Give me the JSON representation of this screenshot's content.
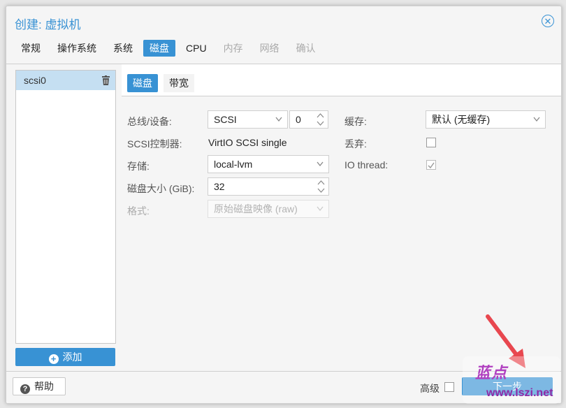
{
  "window": {
    "title": "创建: 虚拟机"
  },
  "tabs": [
    {
      "label": "常规",
      "state": "normal"
    },
    {
      "label": "操作系统",
      "state": "normal"
    },
    {
      "label": "系统",
      "state": "normal"
    },
    {
      "label": "磁盘",
      "state": "active"
    },
    {
      "label": "CPU",
      "state": "normal"
    },
    {
      "label": "内存",
      "state": "disabled"
    },
    {
      "label": "网络",
      "state": "disabled"
    },
    {
      "label": "确认",
      "state": "disabled"
    }
  ],
  "disk_list": {
    "items": [
      {
        "label": "scsi0"
      }
    ],
    "add_label": "添加"
  },
  "inner_tabs": {
    "disk": "磁盘",
    "bandwidth": "带宽"
  },
  "form": {
    "bus_label": "总线/设备:",
    "bus_value": "SCSI",
    "device_value": "0",
    "controller_label": "SCSI控制器:",
    "controller_value": "VirtIO SCSI single",
    "storage_label": "存储:",
    "storage_value": "local-lvm",
    "size_label": "磁盘大小 (GiB):",
    "size_value": "32",
    "format_label": "格式:",
    "format_value": "原始磁盘映像 (raw)",
    "cache_label": "缓存:",
    "cache_value": "默认 (无缓存)",
    "discard_label": "丢弃:",
    "discard_checked": false,
    "iothread_label": "IO thread:",
    "iothread_checked": true
  },
  "footer": {
    "help_label": "帮助",
    "advanced_label": "高级",
    "next_label": "下一步"
  },
  "watermark": {
    "logo": "蓝点",
    "url": "www.lszi.net"
  },
  "colors": {
    "accent": "#3892d4",
    "selection": "#c5dff2",
    "arrow": "#e8474f",
    "watermark": "#b03fc0"
  }
}
